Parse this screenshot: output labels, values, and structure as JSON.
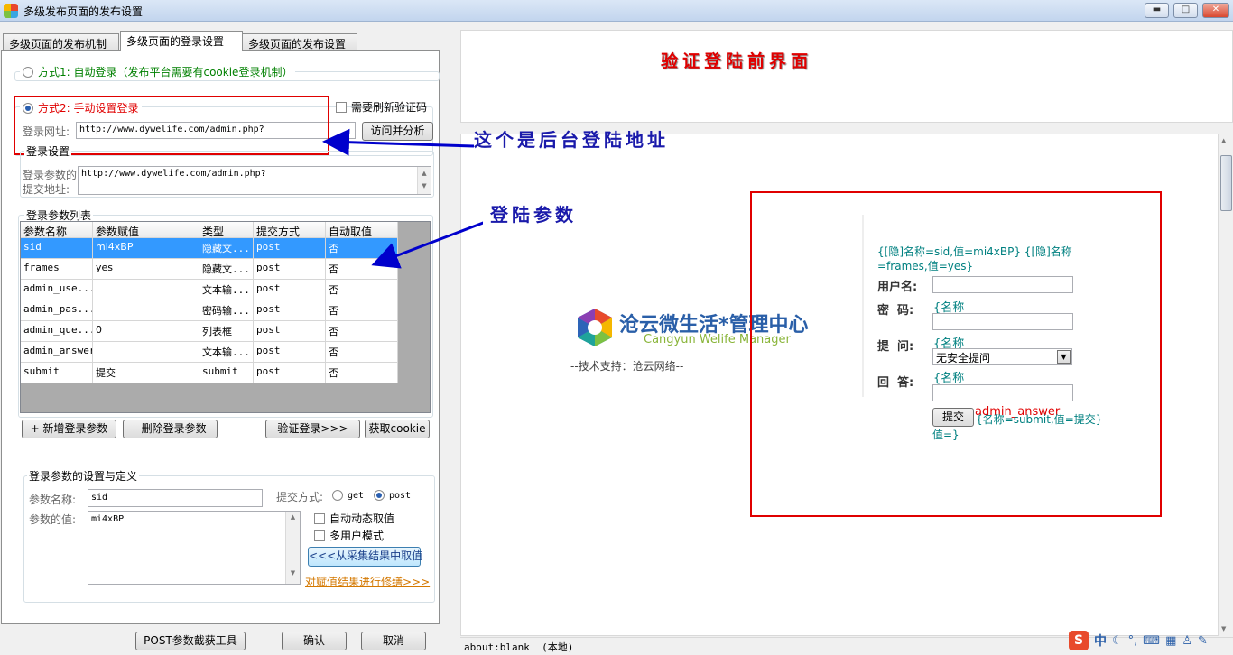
{
  "window": {
    "title": "多级发布页面的发布设置",
    "buttons": {
      "minimize": "▬",
      "maximize": "□",
      "close": "✕"
    }
  },
  "tabs": [
    {
      "label": "多级页面的发布机制"
    },
    {
      "label": "多级页面的登录设置"
    },
    {
      "label": "多级页面的发布设置"
    }
  ],
  "login_mode": {
    "auto_label": "方式1: 自动登录（发布平台需要有cookie登录机制）",
    "manual_label": "方式2: 手动设置登录",
    "refresh_captcha_label": "需要刷新验证码",
    "login_url_label": "登录网址:",
    "login_url_value": "http://www.dywelife.com/admin.php?",
    "visit_button": "访问并分析"
  },
  "login_settings": {
    "legend": "登录设置",
    "submit_addr_label_1": "登录参数的",
    "submit_addr_label_2": "提交地址:",
    "submit_addr_value": "http://www.dywelife.com/admin.php?"
  },
  "param_list": {
    "legend": "登录参数列表",
    "columns": [
      "参数名称",
      "参数赋值",
      "类型",
      "提交方式",
      "自动取值"
    ],
    "rows": [
      [
        "sid",
        "mi4xBP",
        "隐藏文...",
        "post",
        "否"
      ],
      [
        "frames",
        "yes",
        "隐藏文...",
        "post",
        "否"
      ],
      [
        "admin_use...",
        "",
        "文本输...",
        "post",
        "否"
      ],
      [
        "admin_pas...",
        "",
        "密码输...",
        "post",
        "否"
      ],
      [
        "admin_que...",
        "0",
        "列表框",
        "post",
        "否"
      ],
      [
        "admin_answer",
        "",
        "文本输...",
        "post",
        "否"
      ],
      [
        "submit",
        "提交",
        "submit",
        "post",
        "否"
      ]
    ]
  },
  "list_buttons": {
    "add": "+ 新增登录参数",
    "delete": "- 删除登录参数",
    "verify": "验证登录>>>",
    "get_cookie": "获取cookie"
  },
  "param_def": {
    "legend": "登录参数的设置与定义",
    "name_label": "参数名称:",
    "name_value": "sid",
    "method_label": "提交方式:",
    "get_label": "get",
    "post_label": "post",
    "value_label": "参数的值:",
    "value_value": "mi4xBP",
    "auto_dynamic_label": "自动动态取值",
    "multi_user_label": "多用户模式",
    "take_from_collect_button": "<<<从采集结果中取值",
    "modify_link": "对赋值结果进行修缮>>>"
  },
  "footer_buttons": {
    "post_tool": "POST参数截获工具",
    "ok": "确认",
    "cancel": "取消"
  },
  "browser": {
    "heading": "验证登陆前界面",
    "annotation_url": "这个是后台登陆地址",
    "annotation_params": "登陆参数",
    "logo_title": "沧云微生活*管理中心",
    "logo_subtitle": "Cangyun Welife Manager",
    "support_text": "--技术支持：沧云网络--",
    "hidden_fields_line1": "{[隐]名称=sid,值=mi4xBP} {[隐]名称",
    "hidden_fields_line2": "=frames,值=yes}",
    "username_label": "用户名:",
    "password_label": "密  码:",
    "question_label": "提  问:",
    "answer_label": "回  答:",
    "name_tag": "{名称",
    "question_option": "无安全提问",
    "submit_label": "提交",
    "submit_info": "{名称=submit,值=提交}",
    "value_tag": "值=}",
    "answer_overlay": "admin_answer",
    "statusbar": "about:blank  (本地)"
  },
  "tray": {
    "ime_label": "中"
  },
  "colors": {
    "accent_red": "#e00000",
    "selection_blue": "#3399ff",
    "annotation_blue": "#1a1aaa",
    "arrow_blue": "#0000cc"
  }
}
